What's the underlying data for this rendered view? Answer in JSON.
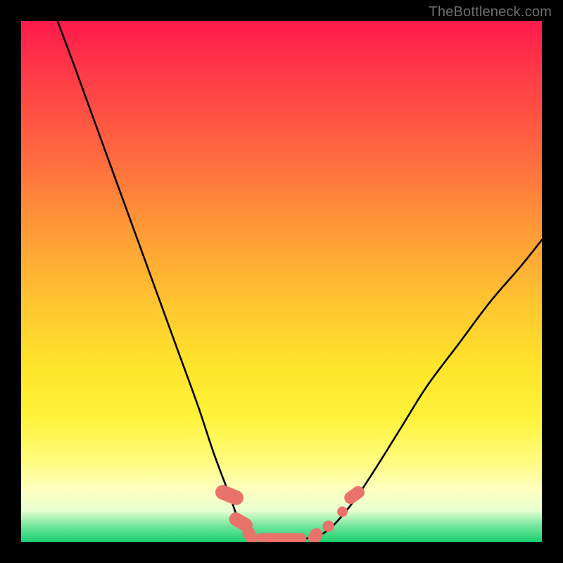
{
  "watermark": "TheBottleneck.com",
  "chart_data": {
    "type": "line",
    "title": "",
    "xlabel": "",
    "ylabel": "",
    "xlim": [
      0,
      100
    ],
    "ylim": [
      0,
      100
    ],
    "series": [
      {
        "name": "left-branch",
        "x": [
          7,
          10,
          14,
          18,
          22,
          26,
          30,
          34,
          37,
          40,
          42,
          43.5
        ],
        "y": [
          100,
          92,
          81,
          70,
          59,
          48,
          37,
          26,
          17,
          9,
          3.5,
          1.2
        ]
      },
      {
        "name": "trough",
        "x": [
          43.5,
          46,
          49,
          52,
          55,
          57.5
        ],
        "y": [
          1.2,
          0.6,
          0.5,
          0.5,
          0.7,
          1.3
        ]
      },
      {
        "name": "right-branch",
        "x": [
          57.5,
          60,
          64,
          68,
          73,
          78,
          84,
          90,
          96,
          100
        ],
        "y": [
          1.3,
          3.2,
          8,
          14,
          22,
          30,
          38,
          46,
          53,
          58
        ]
      }
    ],
    "markers": [
      {
        "shape": "pill",
        "cx": 40.0,
        "cy": 9.0,
        "rx": 1.4,
        "ry": 2.8,
        "angle": -68
      },
      {
        "shape": "pill",
        "cx": 42.2,
        "cy": 3.8,
        "rx": 1.3,
        "ry": 2.4,
        "angle": -60
      },
      {
        "shape": "pill",
        "cx": 44.0,
        "cy": 1.3,
        "rx": 1.2,
        "ry": 1.7,
        "angle": -35
      },
      {
        "shape": "pill",
        "cx": 50.0,
        "cy": 0.55,
        "rx": 4.8,
        "ry": 1.15,
        "angle": 0
      },
      {
        "shape": "pill",
        "cx": 56.5,
        "cy": 1.1,
        "rx": 1.2,
        "ry": 1.6,
        "angle": 30
      },
      {
        "shape": "dot",
        "cx": 59.0,
        "cy": 3.0,
        "r": 1.1
      },
      {
        "shape": "dot",
        "cx": 61.7,
        "cy": 5.8,
        "r": 1.0
      },
      {
        "shape": "pill",
        "cx": 64.0,
        "cy": 9.0,
        "rx": 1.2,
        "ry": 2.1,
        "angle": 55
      }
    ],
    "marker_color": "#e9736b",
    "curve_color": "#000000"
  }
}
